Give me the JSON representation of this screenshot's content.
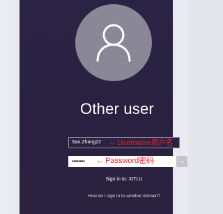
{
  "login": {
    "title": "Other user",
    "username_value": "San.Zhang22",
    "password_mask": "••••••••",
    "submit_icon": "arrow-right-icon",
    "sign_in_to": "Sign in to: XITLU",
    "other_domain_link": "How do I sign in to another domain?"
  },
  "annotations": {
    "username_note": "Username用户名",
    "password_note": "Password密码",
    "arrow": "←",
    "color": "#e8232d"
  },
  "colors": {
    "panel_background": "#2b2345",
    "avatar": "#8a8796"
  }
}
